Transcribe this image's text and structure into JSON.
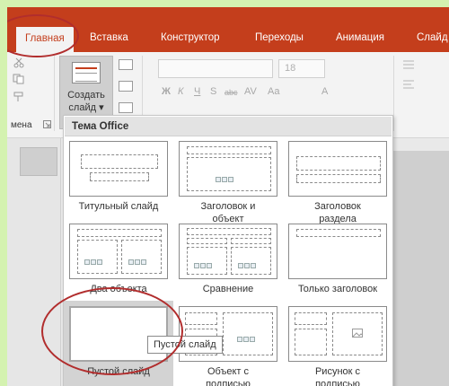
{
  "app": {
    "accent_color": "#c43e1c",
    "tabs": [
      {
        "label": "Главная",
        "active": true
      },
      {
        "label": "Вставка"
      },
      {
        "label": "Конструктор"
      },
      {
        "label": "Переходы"
      },
      {
        "label": "Анимация"
      },
      {
        "label": "Слайд"
      }
    ]
  },
  "ribbon": {
    "new_slide_label": "Создать слайд",
    "new_slide_line1": "Создать",
    "new_slide_line2": "слайд",
    "font_size": "18",
    "group_fragment": "мена",
    "format_buttons": [
      "Ж",
      "К",
      "Ч",
      "S",
      "abc",
      "AV",
      "Aa",
      "A"
    ]
  },
  "gallery": {
    "header": "Тема Office",
    "layouts": [
      {
        "caption_1": "Титульный слайд",
        "caption_2": ""
      },
      {
        "caption_1": "Заголовок и",
        "caption_2": "объект"
      },
      {
        "caption_1": "Заголовок",
        "caption_2": "раздела"
      },
      {
        "caption_1": "Два объекта",
        "caption_2": ""
      },
      {
        "caption_1": "Сравнение",
        "caption_2": ""
      },
      {
        "caption_1": "Только заголовок",
        "caption_2": ""
      },
      {
        "caption_1": "Пустой слайд",
        "caption_2": "",
        "selected": true
      },
      {
        "caption_1": "Объект с",
        "caption_2": "подписью"
      },
      {
        "caption_1": "Рисунок с",
        "caption_2": "подписью"
      }
    ],
    "tooltip": "Пустой слайд"
  }
}
